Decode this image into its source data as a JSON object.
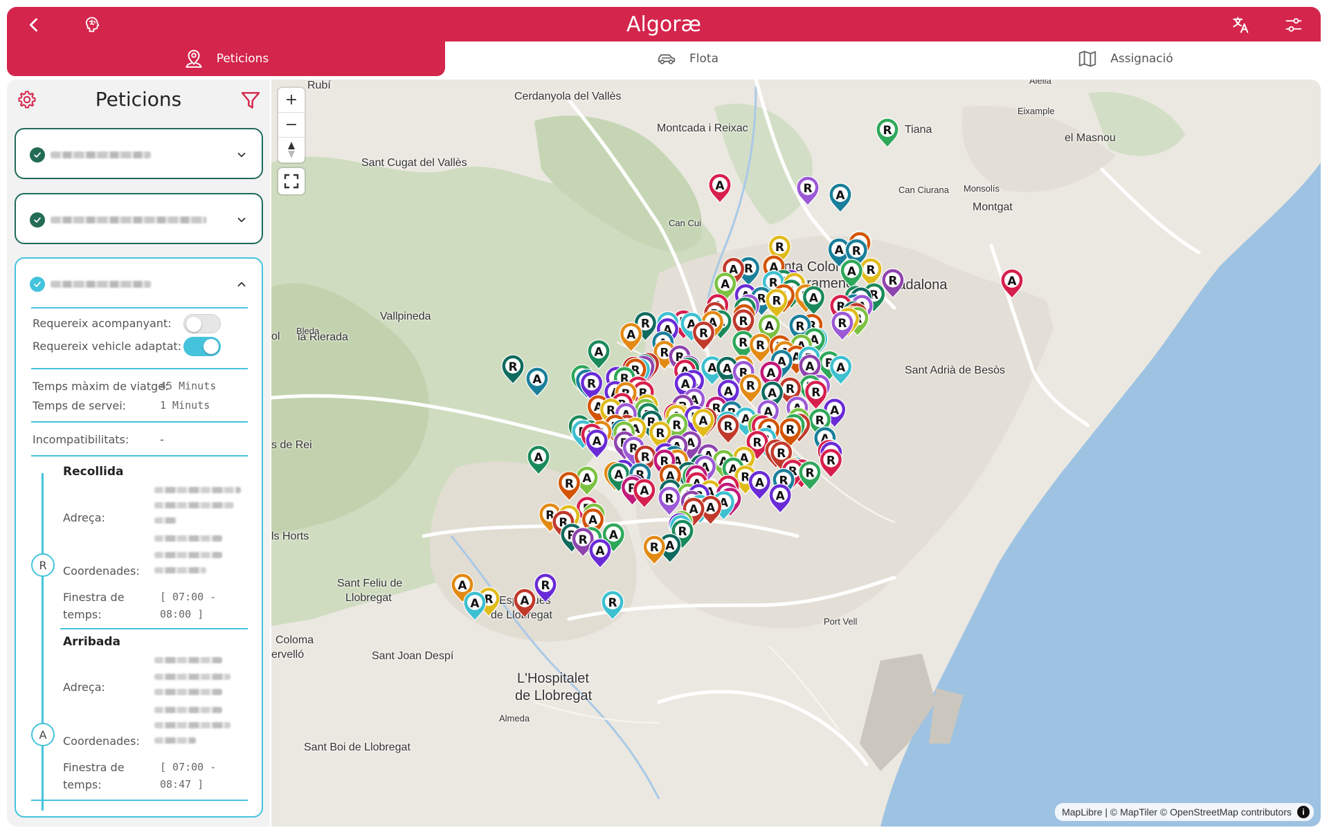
{
  "header": {
    "title": "Algoræ",
    "icons": {
      "back": "chevron-left-icon",
      "logo": "brain-icon",
      "translate": "translate-icon",
      "settings": "sliders-icon"
    },
    "accent": "#d4254c"
  },
  "tabs": [
    {
      "label": "Peticions",
      "icon": "location-person-icon",
      "active": true
    },
    {
      "label": "Flota",
      "icon": "car-icon",
      "active": false
    },
    {
      "label": "Assignació",
      "icon": "map-icon",
      "active": false
    }
  ],
  "sidebar": {
    "title": "Peticions",
    "icons": {
      "settings": "gear-icon",
      "filter": "filter-icon"
    },
    "detail": {
      "requereix_acompanyant_label": "Requereix acompanyant:",
      "requereix_acompanyant": false,
      "requereix_vehicle_label": "Requereix vehicle adaptat:",
      "requereix_vehicle": true,
      "temps_maxim_label": "Temps màxim de viatge:",
      "temps_maxim_value": "45 Minuts",
      "temps_servei_label": "Temps de servei:",
      "temps_servei_value": "1 Minuts",
      "incompat_label": "Incompatibilitats:",
      "incompat_value": "-",
      "recollida": {
        "title": "Recollida",
        "marker": "R",
        "adreca_label": "Adreça:",
        "coord_label": "Coordenades:",
        "finestra_label_1": "Finestra de",
        "finestra_label_2": "temps:",
        "finestra_line1": "[ 07:00 -",
        "finestra_line2": "08:00 ]"
      },
      "arribada": {
        "title": "Arribada",
        "marker": "A",
        "adreca_label": "Adreça:",
        "coord_label": "Coordenades:",
        "finestra_label_1": "Finestra de",
        "finestra_label_2": "temps:",
        "finestra_line1": "[ 07:00 -",
        "finestra_line2": "08:47 ]"
      }
    }
  },
  "map": {
    "controls": {
      "zoom_in": "+",
      "zoom_out": "−"
    },
    "attribution": "MapLibre | © MapTiler © OpenStreetMap contributors",
    "places": [
      {
        "name": "Rubí",
        "size": "md"
      },
      {
        "name": "Cerdanyola del Vallès",
        "size": "md"
      },
      {
        "name": "Montcada i Reixac",
        "size": "md"
      },
      {
        "name": "Tiana",
        "size": "md"
      },
      {
        "name": "el Masnou",
        "size": "md"
      },
      {
        "name": "Alella",
        "size": "sm"
      },
      {
        "name": "Eixample",
        "size": "sm"
      },
      {
        "name": "Sant Cugat del Vallès",
        "size": "md"
      },
      {
        "name": "Can Ciurana",
        "size": "sm"
      },
      {
        "name": "Monsolís",
        "size": "sm"
      },
      {
        "name": "Montgat",
        "size": "md"
      },
      {
        "name": "Can Cui",
        "size": "sm"
      },
      {
        "name": "Santa Coloma",
        "size": "lg"
      },
      {
        "name": "de Gramenet",
        "size": "lg"
      },
      {
        "name": "Badalona",
        "size": "lg"
      },
      {
        "name": "Vallpineda",
        "size": "md"
      },
      {
        "name": "la Rierada",
        "size": "md"
      },
      {
        "name": "Bleda",
        "size": "sm"
      },
      {
        "name": "ol",
        "size": "md"
      },
      {
        "name": "Sant Adrià de Besòs",
        "size": "md"
      },
      {
        "name": "s de Rei",
        "size": "md"
      },
      {
        "name": "ls Horts",
        "size": "md"
      },
      {
        "name": "Sant Feliu de",
        "size": "md"
      },
      {
        "name": "Llobregat",
        "size": "md"
      },
      {
        "name": "Esplugues",
        "size": "md"
      },
      {
        "name": "de Llobregat",
        "size": "md"
      },
      {
        "name": "Coloma",
        "size": "md"
      },
      {
        "name": "ervelló",
        "size": "md"
      },
      {
        "name": "Sant Joan Despí",
        "size": "md"
      },
      {
        "name": "L'Hospitalet",
        "size": "lg"
      },
      {
        "name": "de Llobregat",
        "size": "lg"
      },
      {
        "name": "Almeda",
        "size": "sm"
      },
      {
        "name": "Sant Boi de Llobregat",
        "size": "md"
      },
      {
        "name": "Port Vell",
        "size": "sm"
      }
    ]
  }
}
